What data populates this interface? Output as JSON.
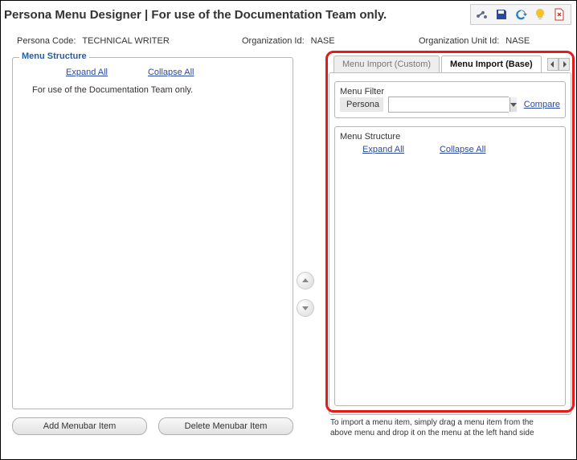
{
  "header": {
    "title": "Persona Menu Designer | For use of the Documentation Team only."
  },
  "info": {
    "personaCode": {
      "label": "Persona Code:",
      "value": "TECHNICAL WRITER"
    },
    "orgId": {
      "label": "Organization Id:",
      "value": "NASE"
    },
    "orgUnitId": {
      "label": "Organization Unit Id:",
      "value": "NASE"
    }
  },
  "left": {
    "legend": "Menu Structure",
    "expandAll": "Expand All",
    "collapseAll": "Collapse All",
    "treeItem": "For use of the Documentation Team only.",
    "addBtn": "Add Menubar Item",
    "deleteBtn": "Delete Menubar Item"
  },
  "right": {
    "tabs": {
      "custom": "Menu Import (Custom)",
      "base": "Menu Import (Base)"
    },
    "filter": {
      "legend": "Menu Filter",
      "personaLabel": "Persona",
      "personaValue": "",
      "compare": "Compare"
    },
    "struct": {
      "legend": "Menu Structure",
      "expandAll": "Expand All",
      "collapseAll": "Collapse All"
    },
    "hintLine1": "To import a menu item, simply drag a menu item from the",
    "hintLine2": "above menu and drop it on the menu at the left hand side"
  }
}
